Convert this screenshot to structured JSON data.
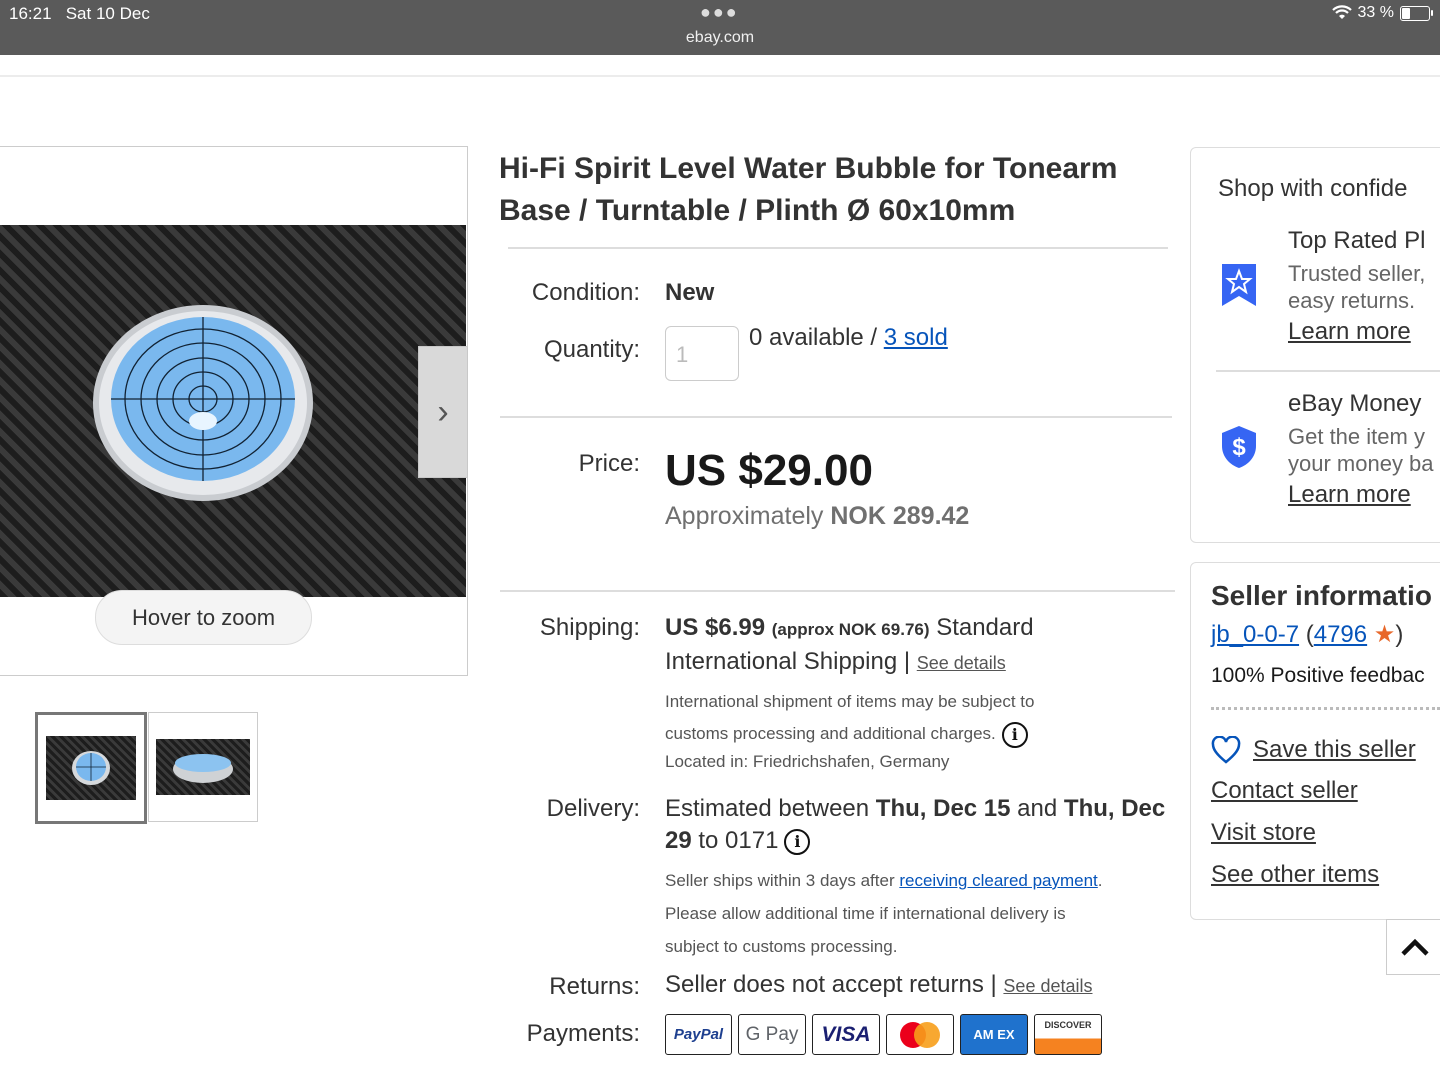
{
  "status_bar": {
    "time": "16:21",
    "date": "Sat 10 Dec",
    "url": "ebay.com",
    "battery": "33 %",
    "battery_level": 0.33
  },
  "gallery": {
    "zoom_hint": "Hover to zoom",
    "thumbnail_count": 2,
    "selected_thumbnail": 0
  },
  "product": {
    "title": "Hi-Fi Spirit Level Water Bubble for Tonearm Base / Turntable / Plinth Ø 60x10mm",
    "condition_label": "Condition:",
    "condition": "New",
    "quantity_label": "Quantity:",
    "quantity_placeholder": "1",
    "available": "0 available / ",
    "sold": "3 sold",
    "price_label": "Price:",
    "price": "US $29.00",
    "approx_prefix": "Approximately ",
    "approx_value": "NOK 289.42"
  },
  "shipping": {
    "label": "Shipping:",
    "cost": "US $6.99",
    "approx": "(approx NOK 69.76)",
    "method_a": "Standard",
    "method_b": "International Shipping | ",
    "see_details": "See details",
    "note_a": "International shipment of items may be subject to",
    "note_b": "customs processing and additional charges.",
    "location": "Located in: Friedrichshafen, Germany"
  },
  "delivery": {
    "label": "Delivery:",
    "line_a_prefix": "Estimated between ",
    "date_from": "Thu, Dec 15",
    "line_a_mid": " and ",
    "date_to_a": "Thu, Dec",
    "date_to_b": "29",
    "line_b_suffix": " to 0171",
    "ships_prefix": "Seller ships within 3 days after ",
    "ships_link": "receiving cleared payment",
    "ships_suffix": ".",
    "note_a": "Please allow additional time if international delivery is",
    "note_b": "subject to customs processing."
  },
  "returns": {
    "label": "Returns:",
    "text": "Seller does not accept returns | ",
    "see_details": "See details"
  },
  "payments": {
    "label": "Payments:",
    "methods": [
      "PayPal",
      "G Pay",
      "VISA",
      "Mastercard",
      "AM EX",
      "DISCOVER"
    ]
  },
  "confidence": {
    "heading": "Shop with confide",
    "items": [
      {
        "title": "Top Rated Pl",
        "line_a": "Trusted seller,",
        "line_b": "easy returns.",
        "link": "Learn more",
        "icon": "star-ribbon-icon"
      },
      {
        "title": "eBay Money",
        "line_a": "Get the item y",
        "line_b": "your money ba",
        "link": "Learn more",
        "icon": "dollar-shield-icon"
      }
    ]
  },
  "seller": {
    "heading": "Seller informatio",
    "name": "jb_0-0-7",
    "score": "4796",
    "feedback": "100% Positive feedbac",
    "save": "Save this seller",
    "contact": "Contact seller",
    "visit": "Visit store",
    "other": "See other items"
  },
  "colors": {
    "link": "#0654ba",
    "status_bar": "#5a5a5a",
    "badge_blue": "#3665f3",
    "level_blue": "#6fb0e8"
  }
}
